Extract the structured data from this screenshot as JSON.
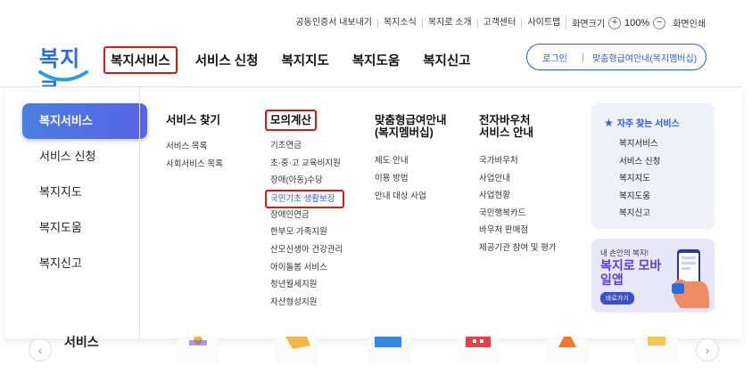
{
  "utility": {
    "links": [
      "공동인증서 내보내기",
      "복지소식",
      "복지로 소개",
      "고객센터",
      "사이트맵"
    ],
    "zoom_label": "화면크기",
    "zoom_plus": "+",
    "zoom_value": "100%",
    "zoom_minus": "−",
    "print_label": "화면인쇄"
  },
  "logo": {
    "text": "복지로"
  },
  "gnb": {
    "items": [
      "복지서비스",
      "서비스 신청",
      "복지지도",
      "복지도움",
      "복지신고"
    ]
  },
  "login": {
    "login_label": "로그인",
    "guide_label": "맞춤형급여안내(복지멤버십)"
  },
  "side_menu": {
    "items": [
      "복지서비스",
      "서비스 신청",
      "복지지도",
      "복지도움",
      "복지신고"
    ]
  },
  "columns": {
    "find": {
      "title": "서비스 찾기",
      "items": [
        "서비스 목록",
        "사회서비스 목록"
      ]
    },
    "calc": {
      "title": "모의계산",
      "items": [
        "기초연금",
        "초·중·고 교육비지원",
        "장애(아동)수당",
        "국민기초 생활보장",
        "장애인연금",
        "한부모 가족지원",
        "산모신생아 건강관리",
        "아이돌봄 서비스",
        "청년월세지원",
        "자산형성지원"
      ]
    },
    "membership": {
      "title": "맞춤형급여안내 (복지멤버십)",
      "items": [
        "제도 안내",
        "이용 방법",
        "안내 대상 사업"
      ]
    },
    "voucher": {
      "title": "전자바우처 서비스 안내",
      "items": [
        "국가바우처",
        "사업안내",
        "사업현황",
        "국민행복카드",
        "바우처 판매점",
        "제공기관 참여 및 평가"
      ]
    }
  },
  "faq": {
    "title": "자주 찾는 서비스",
    "items": [
      "복지서비스",
      "서비스 신청",
      "복지지도",
      "복지도움",
      "복지신고"
    ]
  },
  "banner": {
    "subtitle": "내 손안의 복지!",
    "title": "복지로 모바일앱",
    "button": "바로가기"
  },
  "bottom": {
    "label": "서비스",
    "prev": "‹",
    "next": "›"
  },
  "colors": {
    "accent": "#2b5fd9",
    "highlight": "#d71920",
    "side_active": "#4a7ee0"
  }
}
